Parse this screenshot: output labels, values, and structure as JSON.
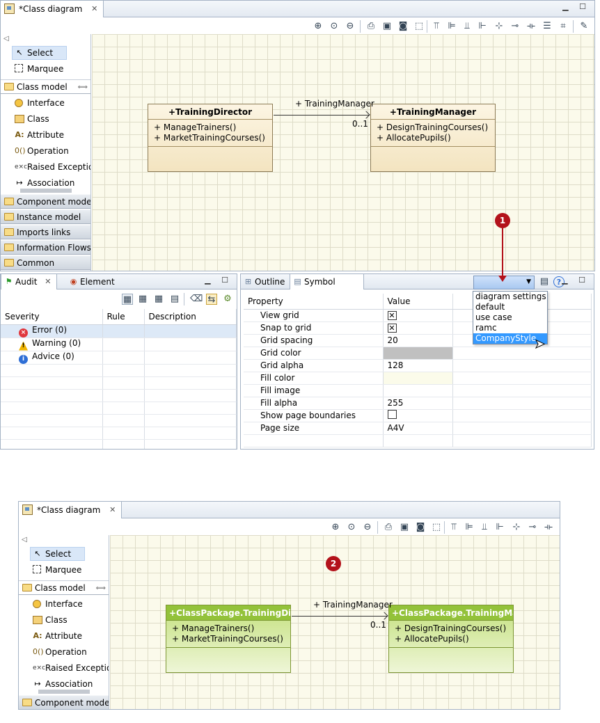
{
  "top_editor": {
    "tab_title": "*Class diagram",
    "palette": {
      "tools": [
        {
          "label": "Select",
          "icon": "arrow-cursor-icon"
        },
        {
          "label": "Marquee",
          "icon": "marquee-icon"
        }
      ],
      "class_model": {
        "label": "Class model",
        "items": [
          {
            "label": "Interface",
            "icon": "interface-circle-icon"
          },
          {
            "label": "Class",
            "icon": "class-box-icon"
          },
          {
            "label": "Attribute",
            "icon": "attribute-icon"
          },
          {
            "label": "Operation",
            "icon": "operation-icon"
          },
          {
            "label": "Raised Exception",
            "icon": "exception-icon"
          },
          {
            "label": "Association",
            "icon": "association-arrow-icon"
          }
        ]
      },
      "drawers": [
        "Component model",
        "Instance model",
        "Imports links",
        "Information Flows",
        "Common"
      ]
    },
    "diagram": {
      "class_a": {
        "name": "+TrainingDirector",
        "ops": [
          "+ ManageTrainers()",
          "+ MarketTrainingCourses()"
        ]
      },
      "class_b": {
        "name": "+TrainingManager",
        "ops": [
          "+ DesignTrainingCourses()",
          "+ AllocatePupils()"
        ]
      },
      "association": {
        "role": "+ TrainingManager",
        "multiplicity": "0..1"
      }
    }
  },
  "audit_view": {
    "tabs": [
      "Audit",
      "Element"
    ],
    "columns": [
      "Severity",
      "Rule",
      "Description"
    ],
    "rows": [
      {
        "severity": "Error (0)",
        "color": "#e0383e"
      },
      {
        "severity": "Warning (0)",
        "color": "#f0b400"
      },
      {
        "severity": "Advice (0)",
        "color": "#2f6fd6"
      }
    ]
  },
  "symbol_view": {
    "tabs": [
      "Outline",
      "Symbol"
    ],
    "columns": [
      "Property",
      "Value"
    ],
    "properties": [
      {
        "name": "View grid",
        "value": "",
        "kind": "checkbox-checked"
      },
      {
        "name": "Snap to grid",
        "value": "",
        "kind": "checkbox-checked"
      },
      {
        "name": "Grid spacing",
        "value": "20",
        "kind": "text"
      },
      {
        "name": "Grid color",
        "value": "",
        "kind": "color-gray"
      },
      {
        "name": "Grid alpha",
        "value": "128",
        "kind": "text"
      },
      {
        "name": "Fill color",
        "value": "",
        "kind": "color-cream"
      },
      {
        "name": "Fill image",
        "value": "",
        "kind": "text"
      },
      {
        "name": "Fill alpha",
        "value": "255",
        "kind": "text"
      },
      {
        "name": "Show page boundaries",
        "value": "",
        "kind": "checkbox-empty"
      },
      {
        "name": "Page size",
        "value": "A4V",
        "kind": "text"
      }
    ],
    "style_dropdown": {
      "options": [
        "diagram settings",
        "default",
        "use case",
        "ramc",
        "CompanyStyle"
      ],
      "selected": "CompanyStyle"
    }
  },
  "bottom_editor": {
    "tab_title": "*Class diagram",
    "palette": {
      "tools": [
        {
          "label": "Select",
          "icon": "arrow-cursor-icon"
        },
        {
          "label": "Marquee",
          "icon": "marquee-icon"
        }
      ],
      "class_model": {
        "label": "Class model",
        "items": [
          {
            "label": "Interface"
          },
          {
            "label": "Class"
          },
          {
            "label": "Attribute"
          },
          {
            "label": "Operation"
          },
          {
            "label": "Raised Exception"
          },
          {
            "label": "Association"
          }
        ]
      },
      "drawers": [
        "Component model"
      ]
    },
    "diagram": {
      "class_a": {
        "name": "+ClassPackage.TrainingDire...",
        "ops": [
          "+ ManageTrainers()",
          "+ MarketTrainingCourses()"
        ]
      },
      "class_b": {
        "name": "+ClassPackage.TrainingMan...",
        "ops": [
          "+ DesignTrainingCourses()",
          "+ AllocatePupils()"
        ]
      },
      "association": {
        "role": "+ TrainingManager",
        "multiplicity": "0..1"
      }
    }
  },
  "callouts": [
    "1",
    "2"
  ]
}
